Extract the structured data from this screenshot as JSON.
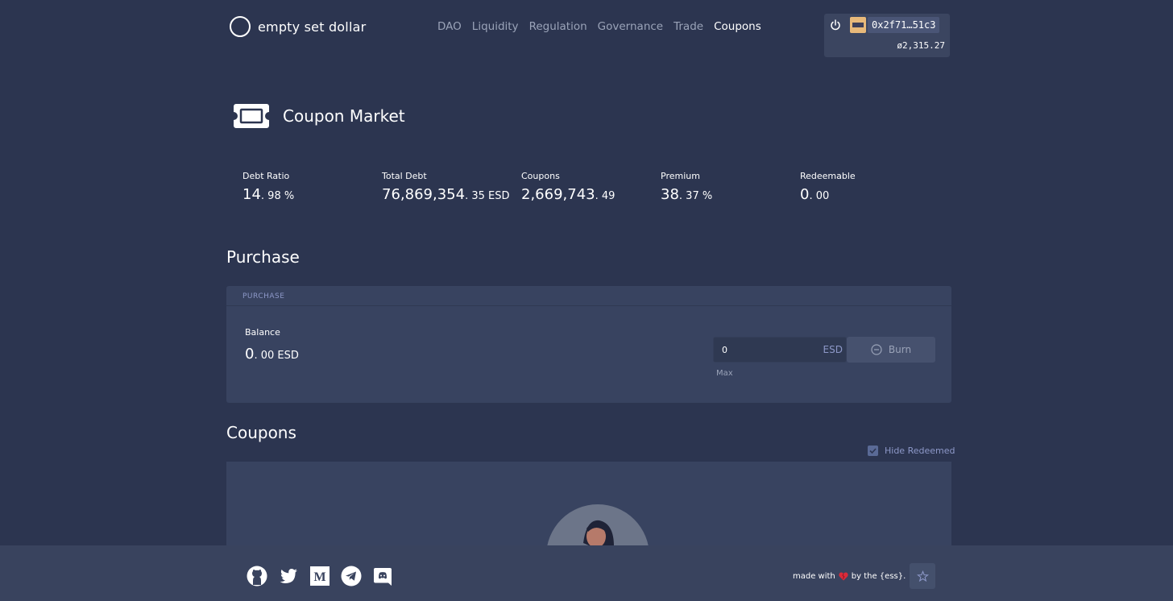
{
  "brand": {
    "name": "empty set dollar"
  },
  "nav": {
    "items": [
      {
        "label": "DAO",
        "active": false
      },
      {
        "label": "Liquidity",
        "active": false
      },
      {
        "label": "Regulation",
        "active": false
      },
      {
        "label": "Governance",
        "active": false
      },
      {
        "label": "Trade",
        "active": false
      },
      {
        "label": "Coupons",
        "active": true
      }
    ]
  },
  "wallet": {
    "address": "0x2f71…51c3",
    "balance": "ø2,315.27"
  },
  "page": {
    "title": "Coupon Market",
    "icon": "ticket-icon"
  },
  "stats": [
    {
      "label": "Debt Ratio",
      "int": "14",
      "dec": ". 98 %"
    },
    {
      "label": "Total Debt",
      "int": "76,869,354",
      "dec": ". 35 ESD"
    },
    {
      "label": "Coupons",
      "int": "2,669,743",
      "dec": ". 49"
    },
    {
      "label": "Premium",
      "int": "38",
      "dec": ". 37 %"
    },
    {
      "label": "Redeemable",
      "int": "0",
      "dec": ". 00"
    }
  ],
  "purchase": {
    "section_title": "Purchase",
    "box_header": "PURCHASE",
    "balance_label": "Balance",
    "balance_int": "0",
    "balance_dec": ". 00 ESD",
    "input_value": "0",
    "input_unit": "ESD",
    "burn_label": "Burn",
    "max_label": "Max"
  },
  "coupons": {
    "section_title": "Coupons",
    "hide_redeemed_label": "Hide Redeemed",
    "hide_redeemed_checked": true
  },
  "footer": {
    "social_icons": [
      "github-icon",
      "twitter-icon",
      "medium-icon",
      "telegram-icon",
      "discord-icon"
    ],
    "made_with_prefix": "made with",
    "made_with_suffix": "by the {ess}."
  }
}
